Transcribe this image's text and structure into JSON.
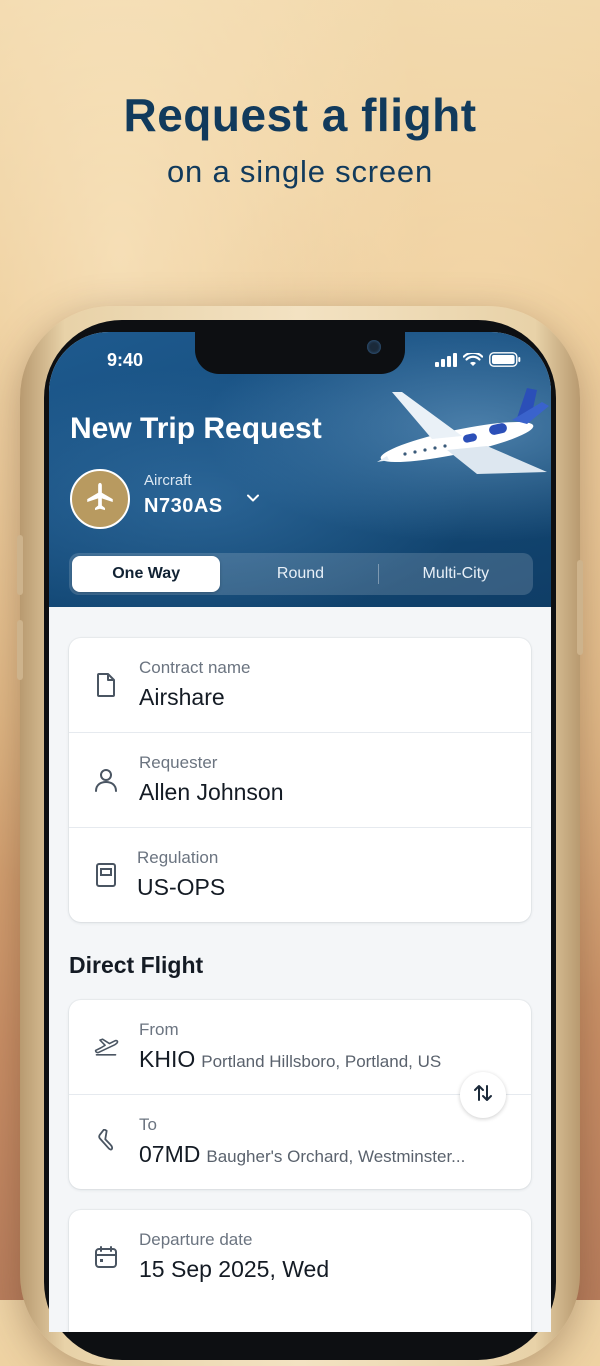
{
  "marketing": {
    "headline": "Request a flight",
    "subheadline": "on a single screen"
  },
  "status_bar": {
    "time": "9:40",
    "icons": [
      "cellular-signal-icon",
      "wifi-icon",
      "battery-icon"
    ]
  },
  "header": {
    "title": "New Trip Request",
    "aircraft_label": "Aircraft",
    "aircraft_value": "N730AS"
  },
  "trip_type_tabs": [
    {
      "label": "One Way",
      "selected": true
    },
    {
      "label": "Round",
      "selected": false
    },
    {
      "label": "Multi-City",
      "selected": false
    }
  ],
  "trip_info": {
    "contract": {
      "label": "Contract name",
      "value": "Airshare",
      "icon": "document-icon"
    },
    "requester": {
      "label": "Requester",
      "value": "Allen Johnson",
      "icon": "user-icon"
    },
    "regulation": {
      "label": "Regulation",
      "value": "US-OPS",
      "icon": "book-icon"
    }
  },
  "direct_flight": {
    "section_title": "Direct Flight",
    "from": {
      "label": "From",
      "code": "KHIO",
      "name": "Portland Hillsboro, Portland, US",
      "icon": "takeoff-icon"
    },
    "to": {
      "label": "To",
      "code": "07MD",
      "name": "Baugher's Orchard, Westminster...",
      "icon": "landing-icon"
    },
    "swap_icon": "swap-vertical-icon"
  },
  "departure": {
    "label": "Departure date",
    "value": "15 Sep 2025, Wed",
    "icon": "calendar-icon"
  },
  "colors": {
    "headline": "#113a5c",
    "header_blue": "#174f80",
    "aircraft_gold": "#b89a60"
  }
}
